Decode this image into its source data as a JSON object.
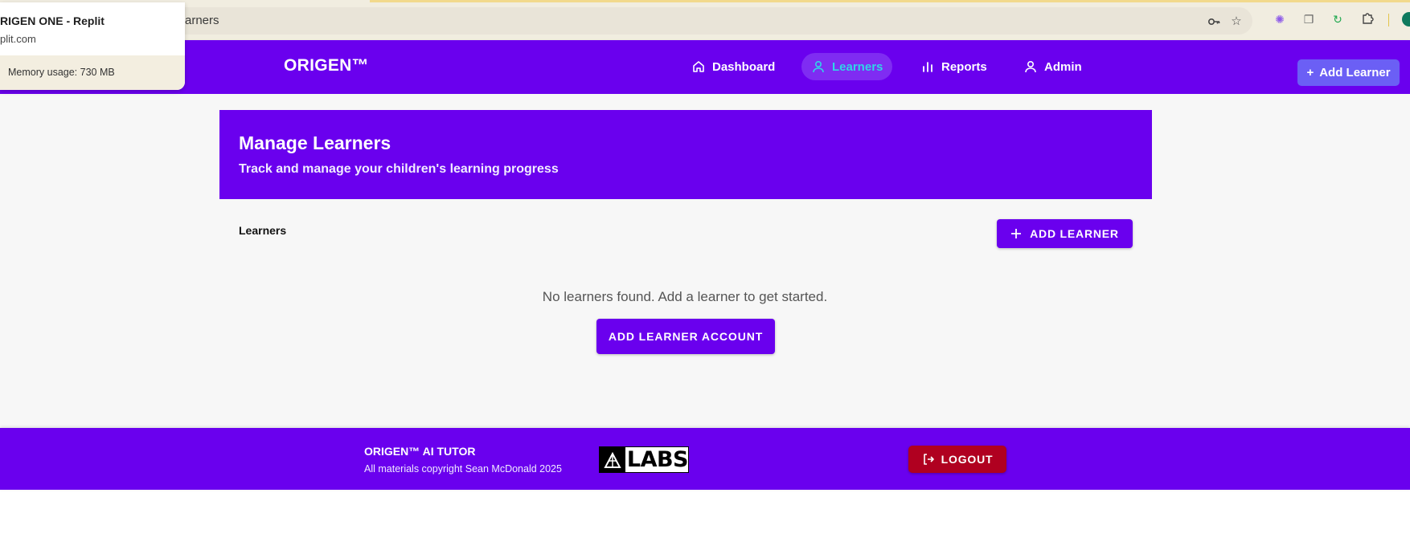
{
  "browser": {
    "address_text": "arners",
    "icons": [
      "key-icon",
      "star-icon",
      "extension-icon",
      "copy-icon",
      "refresh-icon",
      "puzzle-icon",
      "profile-avatar"
    ]
  },
  "hover_card": {
    "title": "RIGEN ONE - Replit",
    "url": "plit.com",
    "memory": "Memory usage: 730 MB"
  },
  "app": {
    "logo": "ORIGEN™",
    "nav": [
      {
        "label": "Dashboard",
        "icon": "home-icon",
        "active": false
      },
      {
        "label": "Learners",
        "icon": "user-icon",
        "active": true
      },
      {
        "label": "Reports",
        "icon": "bar-chart-icon",
        "active": false
      },
      {
        "label": "Admin",
        "icon": "user-icon",
        "active": false
      }
    ],
    "top_add_button": "Add Learner"
  },
  "hero": {
    "title": "Manage Learners",
    "subtitle": "Track and manage your children's learning progress"
  },
  "learners": {
    "section_label": "Learners",
    "add_button": "ADD LEARNER",
    "empty_message": "No learners found. Add a learner to get started.",
    "add_account_button": "ADD LEARNER ACCOUNT"
  },
  "footer": {
    "title": "ORIGEN™ AI TUTOR",
    "copyright": "All materials copyright Sean McDonald 2025",
    "logo_text": "LABS",
    "logout": "LOGOUT"
  },
  "colors": {
    "primary": "#6a00ee",
    "active_nav_text": "#2fd6e6",
    "logout": "#b00020",
    "top_add_button": "#6b5ff5"
  }
}
